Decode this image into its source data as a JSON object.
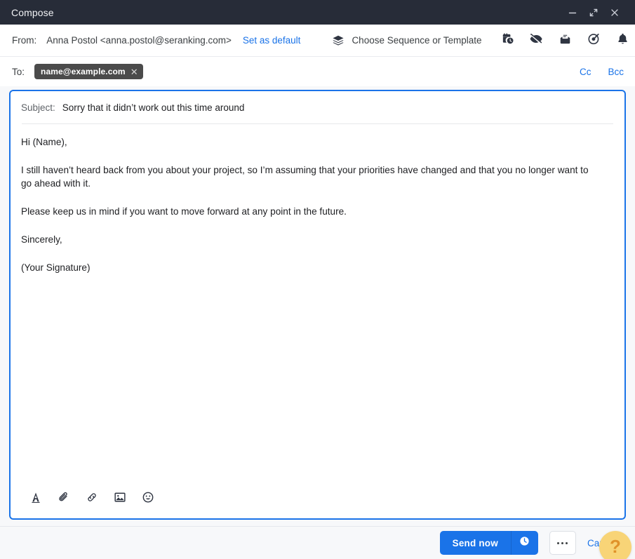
{
  "window": {
    "title": "Compose",
    "controls": [
      {
        "name": "minimize",
        "icon": "minimize-icon"
      },
      {
        "name": "expand",
        "icon": "expand-icon"
      },
      {
        "name": "close",
        "icon": "close-icon"
      }
    ]
  },
  "from": {
    "label": "From:",
    "address": "Anna Postol <anna.postol@seranking.com>",
    "set_default_label": "Set as default",
    "sequence_label": "Choose Sequence or Template",
    "icons": [
      {
        "name": "schedule-send-icon"
      },
      {
        "name": "tracking-off-icon"
      },
      {
        "name": "read-receipt-icon"
      },
      {
        "name": "target-icon"
      },
      {
        "name": "reminder-bell-icon"
      }
    ]
  },
  "to": {
    "label": "To:",
    "recipients": [
      {
        "email": "name@example.com"
      }
    ],
    "cc_label": "Cc",
    "bcc_label": "Bcc"
  },
  "composer": {
    "subject_label": "Subject:",
    "subject_value": "Sorry that it didn’t work out this time around",
    "body": [
      "Hi (Name),",
      "I still haven’t heard back from you about your project, so I’m assuming that your priorities have changed and that you no longer want to go ahead with it.",
      "Please keep us in mind if you want to move forward at any point in the future.",
      "Sincerely,",
      "(Your Signature)"
    ],
    "format_icons": [
      {
        "name": "text-format-icon",
        "glyph": "A"
      },
      {
        "name": "attach-file-icon"
      },
      {
        "name": "insert-link-icon"
      },
      {
        "name": "insert-image-icon"
      },
      {
        "name": "insert-emoji-icon"
      }
    ]
  },
  "footer": {
    "send_label": "Send now",
    "schedule_icon": "clock-icon",
    "more_label": "•••",
    "cancel_label": "Cancel",
    "help_label": "?"
  },
  "colors": {
    "titlebar": "#272c38",
    "accent_blue": "#1a73e8",
    "chip_bg": "#4b4b4b",
    "help_yellow": "#f8d477",
    "page_bg": "#f7f8fa"
  }
}
